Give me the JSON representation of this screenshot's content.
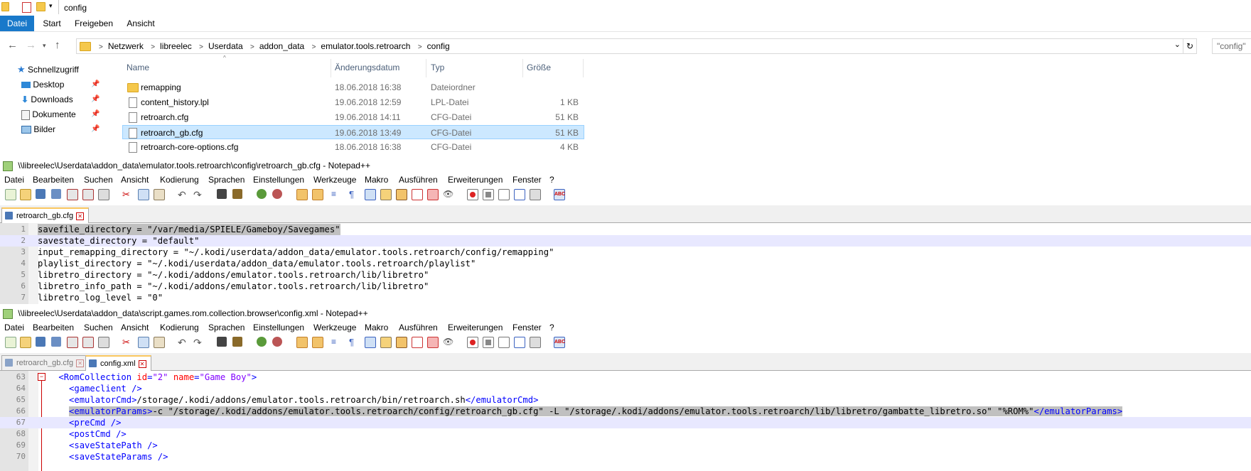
{
  "explorer": {
    "window_title": "config",
    "ribbon_tabs": [
      "Datei",
      "Start",
      "Freigeben",
      "Ansicht"
    ],
    "breadcrumbs": [
      "Netzwerk",
      "libreelec",
      "Userdata",
      "addon_data",
      "emulator.tools.retroarch",
      "config"
    ],
    "search_placeholder": "\"config\"",
    "nav": {
      "quick_access": "Schnellzugriff",
      "items": [
        {
          "label": "Desktop",
          "icon": "desktop-icon"
        },
        {
          "label": "Downloads",
          "icon": "download-icon"
        },
        {
          "label": "Dokumente",
          "icon": "documents-icon"
        },
        {
          "label": "Bilder",
          "icon": "pictures-icon"
        }
      ]
    },
    "columns": {
      "name": "Name",
      "date": "Änderungsdatum",
      "type": "Typ",
      "size": "Größe"
    },
    "files": [
      {
        "name": "remapping",
        "date": "18.06.2018 16:38",
        "type": "Dateiordner",
        "size": "",
        "kind": "folder"
      },
      {
        "name": "content_history.lpl",
        "date": "19.06.2018 12:59",
        "type": "LPL-Datei",
        "size": "1 KB",
        "kind": "file"
      },
      {
        "name": "retroarch.cfg",
        "date": "19.06.2018 14:11",
        "type": "CFG-Datei",
        "size": "51 KB",
        "kind": "file"
      },
      {
        "name": "retroarch_gb.cfg",
        "date": "19.06.2018 13:49",
        "type": "CFG-Datei",
        "size": "51 KB",
        "kind": "file",
        "selected": true
      },
      {
        "name": "retroarch-core-options.cfg",
        "date": "18.06.2018 16:38",
        "type": "CFG-Datei",
        "size": "4 KB",
        "kind": "file"
      }
    ]
  },
  "notepad1": {
    "title": "\\\\libreelec\\Userdata\\addon_data\\emulator.tools.retroarch\\config\\retroarch_gb.cfg - Notepad++",
    "menu": [
      "Datei",
      "Bearbeiten",
      "Suchen",
      "Ansicht",
      "Kodierung",
      "Sprachen",
      "Einstellungen",
      "Werkzeuge",
      "Makro",
      "Ausführen",
      "Erweiterungen",
      "Fenster",
      "?"
    ],
    "tabs": [
      {
        "label": "retroarch_gb.cfg",
        "active": true
      }
    ],
    "lines": [
      {
        "n": "1",
        "text": "savefile_directory = \"/var/media/SPIELE/Gameboy/Savegames\""
      },
      {
        "n": "2",
        "text": "savestate_directory = \"default\""
      },
      {
        "n": "3",
        "text": "input_remapping_directory = \"~/.kodi/userdata/addon_data/emulator.tools.retroarch/config/remapping\""
      },
      {
        "n": "4",
        "text": "playlist_directory = \"~/.kodi/userdata/addon_data/emulator.tools.retroarch/playlist\""
      },
      {
        "n": "5",
        "text": "libretro_directory = \"~/.kodi/addons/emulator.tools.retroarch/lib/libretro\""
      },
      {
        "n": "6",
        "text": "libretro_info_path = \"~/.kodi/addons/emulator.tools.retroarch/lib/libretro\""
      },
      {
        "n": "7",
        "text": "libretro_log_level = \"0\""
      }
    ]
  },
  "notepad2": {
    "title": "\\\\libreelec\\Userdata\\addon_data\\script.games.rom.collection.browser\\config.xml - Notepad++",
    "menu": [
      "Datei",
      "Bearbeiten",
      "Suchen",
      "Ansicht",
      "Kodierung",
      "Sprachen",
      "Einstellungen",
      "Werkzeuge",
      "Makro",
      "Ausführen",
      "Erweiterungen",
      "Fenster",
      "?"
    ],
    "tabs": [
      {
        "label": "retroarch_gb.cfg",
        "active": false
      },
      {
        "label": "config.xml",
        "active": true
      }
    ],
    "lines": [
      {
        "n": "63",
        "indent": "    ",
        "parts": [
          [
            "tag",
            "<RomCollection "
          ],
          [
            "attr",
            "id"
          ],
          [
            "tag",
            "="
          ],
          [
            "str",
            "\"2\""
          ],
          [
            "tag",
            " "
          ],
          [
            "attr",
            "name"
          ],
          [
            "tag",
            "="
          ],
          [
            "str",
            "\"Game Boy\""
          ],
          [
            "tag",
            ">"
          ]
        ]
      },
      {
        "n": "64",
        "indent": "      ",
        "parts": [
          [
            "tag",
            "<gameclient />"
          ]
        ]
      },
      {
        "n": "65",
        "indent": "      ",
        "parts": [
          [
            "tag",
            "<emulatorCmd>"
          ],
          [
            "txt",
            "/storage/.kodi/addons/emulator.tools.retroarch/bin/retroarch.sh"
          ],
          [
            "tag",
            "</emulatorCmd>"
          ]
        ]
      },
      {
        "n": "66",
        "indent": "      ",
        "sel": true,
        "parts": [
          [
            "tag",
            "<emulatorParams>"
          ],
          [
            "txt",
            "-c \"/storage/.kodi/addons/emulator.tools.retroarch/config/retroarch_gb.cfg\" -L \"/storage/.kodi/addons/emulator.tools.retroarch/lib/libretro/gambatte_libretro.so\" \"%ROM%\""
          ],
          [
            "tag",
            "</emulatorParams>"
          ]
        ]
      },
      {
        "n": "67",
        "indent": "      ",
        "cur": true,
        "parts": [
          [
            "tag",
            "<preCmd />"
          ]
        ]
      },
      {
        "n": "68",
        "indent": "      ",
        "parts": [
          [
            "tag",
            "<postCmd />"
          ]
        ]
      },
      {
        "n": "69",
        "indent": "      ",
        "parts": [
          [
            "tag",
            "<saveStatePath />"
          ]
        ]
      },
      {
        "n": "70",
        "indent": "      ",
        "parts": [
          [
            "tag",
            "<saveStateParams />"
          ]
        ]
      }
    ]
  }
}
